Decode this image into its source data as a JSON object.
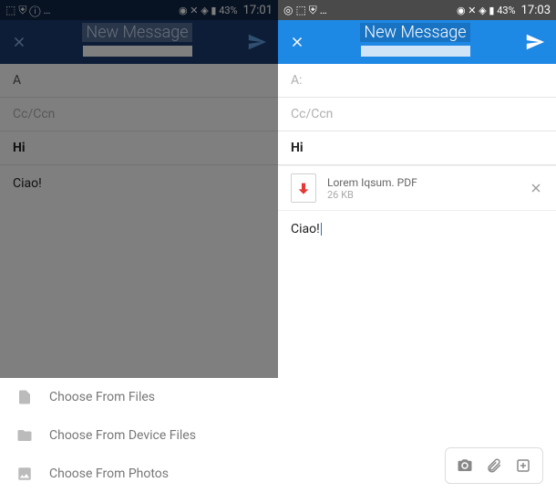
{
  "left": {
    "status": {
      "icons": "⬚ ⛨ ⓘ …",
      "right_icons": "◉ ✕ ◈ ▮ 43%",
      "time": "17:01"
    },
    "appbar": {
      "title": "New Message"
    },
    "fields": {
      "to": "A",
      "cc": "Cc/Ccn",
      "subject": "Hi"
    },
    "body": "Ciao!",
    "sheet": {
      "item1": "Choose From Files",
      "item2": "Choose From Device Files",
      "item3": "Choose From Photos"
    }
  },
  "right": {
    "status": {
      "icons": "◎ ⬚ ⛨ …",
      "right_icons": "◉ ✕ ◈ ▮ 43%",
      "time": "17:03"
    },
    "appbar": {
      "title": "New Message"
    },
    "fields": {
      "to": "A:",
      "cc": "Cc/Ccn",
      "subject": "Hi"
    },
    "attachment": {
      "name": "Lorem Iqsum. PDF",
      "size": "26 KB"
    },
    "body": "Ciao!"
  }
}
